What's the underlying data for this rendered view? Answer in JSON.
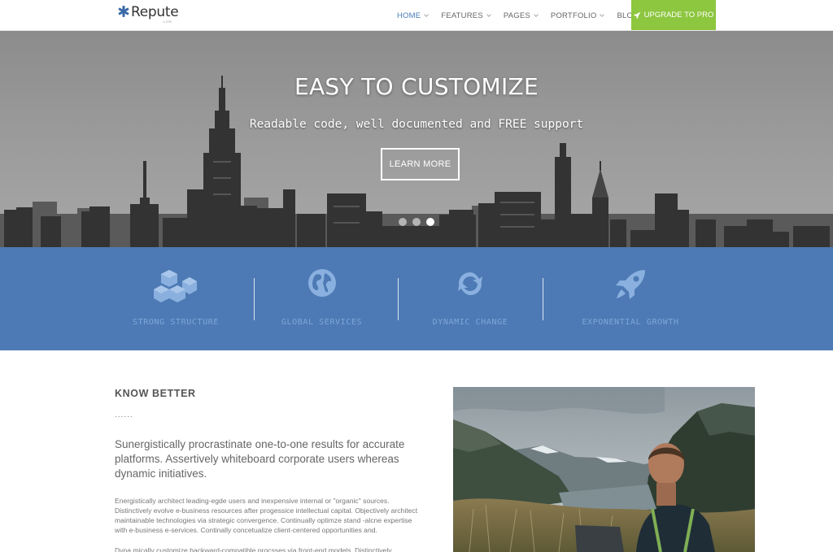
{
  "header": {
    "logo_text": "Repute",
    "logo_sub": "LITE",
    "nav": [
      {
        "label": "HOME",
        "active": true
      },
      {
        "label": "FEATURES"
      },
      {
        "label": "PAGES"
      },
      {
        "label": "PORTFOLIO"
      },
      {
        "label": "BLOG"
      }
    ],
    "upgrade_label": "UPGRADE TO PRO"
  },
  "hero": {
    "title": "EASY TO CUSTOMIZE",
    "subtitle": "Readable code, well documented and FREE support",
    "button_label": "LEARN MORE",
    "slides": 3,
    "active_slide": 3
  },
  "features": [
    {
      "label": "STRONG STRUCTURE",
      "icon": "cubes-icon"
    },
    {
      "label": "GLOBAL SERVICES",
      "icon": "globe-icon"
    },
    {
      "label": "DYNAMIC CHANGE",
      "icon": "refresh-icon"
    },
    {
      "label": "EXPONENTIAL GROWTH",
      "icon": "rocket-icon"
    }
  ],
  "content": {
    "heading": "KNOW BETTER",
    "separator": "......",
    "lead": "Sunergistically procrastinate one-to-one results for accurate platforms. Assertively whiteboard corporate users whereas dynamic initiatives.",
    "body": "Energistically architect leading-egde users and inexpensive internal or \"organic\" sources. Distinctively evolve e-business resources after progessice intellectual capital. Objectively architect maintainable technologies via strategic convergence. Continually optimze stand -alcne expertise with e-business e-services. Continally concetualize client-centered opportunities and.",
    "body2": "Dyna mically customize backward-compatible procsses via front-end models. Distinctively"
  },
  "colors": {
    "accent": "#4a7ab8",
    "upgrade": "#8dc63f",
    "band": "#4d7ab4",
    "feature_text": "#7ea6d8"
  }
}
